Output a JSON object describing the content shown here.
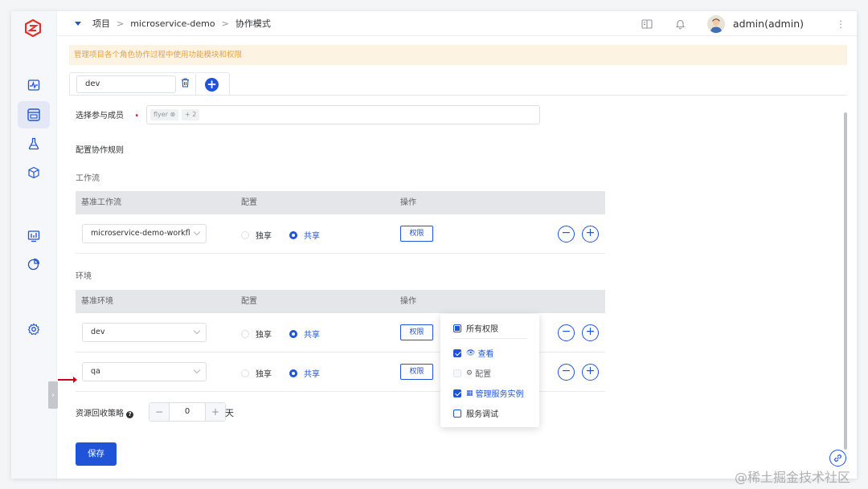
{
  "breadcrumb": {
    "items": [
      "项目",
      "microservice-demo",
      "协作模式"
    ],
    "separator": ">"
  },
  "header": {
    "user": "admin(admin)",
    "more": "⋮"
  },
  "notice": "管理项目各个角色协作过程中使用功能模块和权限",
  "tabs": {
    "active_name": "dev",
    "add_symbol": "+"
  },
  "members": {
    "label": "选择参与成员",
    "required_mark": "•",
    "chips": [
      "flyer ⊗",
      "+ 2"
    ]
  },
  "rules_title": "配置协作规则",
  "workflow": {
    "title": "工作流",
    "headers": [
      "基准工作流",
      "配置",
      "操作"
    ],
    "rows": [
      {
        "name": "microservice-demo-workfl",
        "option1": "独享",
        "option2": "共享",
        "selected": "共享",
        "perm": "权限"
      }
    ]
  },
  "environment": {
    "title": "环境",
    "headers": [
      "基准环境",
      "配置",
      "操作"
    ],
    "rows": [
      {
        "name": "dev",
        "option1": "独享",
        "option2": "共享",
        "selected": "共享",
        "perm": "权限"
      },
      {
        "name": "qa",
        "option1": "独享",
        "option2": "共享",
        "selected": "共享",
        "perm": "权限"
      }
    ]
  },
  "recycle": {
    "label": "资源回收策略",
    "help": "?",
    "minus": "−",
    "value": "0",
    "plus": "+",
    "unit": "天"
  },
  "save_label": "保存",
  "permissions_popover": {
    "all": {
      "label": "所有权限",
      "state": "indeterminate"
    },
    "items": [
      {
        "icon": "👁",
        "label": "查看",
        "checked": true
      },
      {
        "icon": "⚙",
        "label": "配置",
        "checked": false,
        "disabled": true
      },
      {
        "icon": "▦",
        "label": "管理服务实例",
        "checked": true
      },
      {
        "icon": "",
        "label": "服务调试",
        "checked": false
      }
    ]
  },
  "round_buttons": {
    "minus": "−",
    "plus": "+"
  },
  "watermark": "@稀土掘金技术社区",
  "colors": {
    "primary": "#1f53d8",
    "notice_bg": "#fdf3e3",
    "notice_text": "#e6a23c",
    "required": "#e02020"
  }
}
